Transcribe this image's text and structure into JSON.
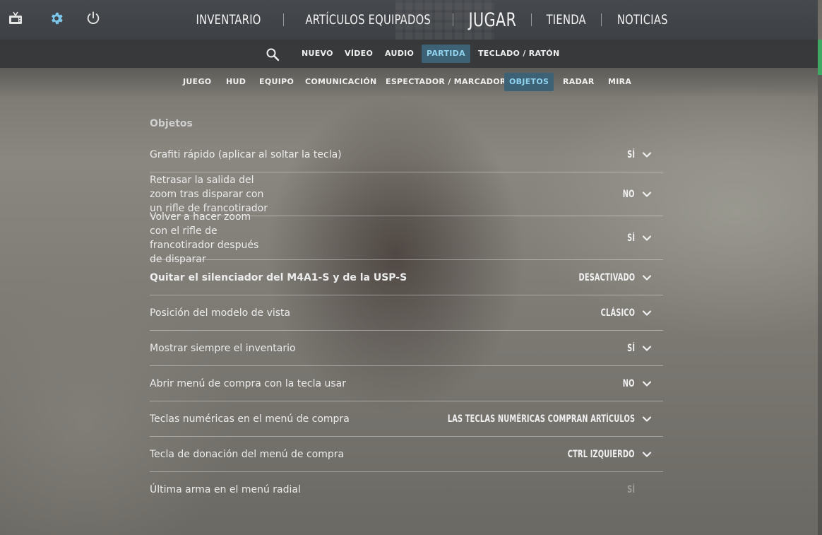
{
  "top_icons": {
    "tv": "tv-icon",
    "settings": "gear-icon",
    "power": "power-icon"
  },
  "main_nav": {
    "items": [
      "INVENTARIO",
      "ARTÍCULOS EQUIPADOS",
      "JUGAR",
      "TIENDA",
      "NOTICIAS"
    ],
    "active": "JUGAR"
  },
  "settings_tabs": {
    "items": [
      "NUEVO",
      "VÍDEO",
      "AUDIO",
      "PARTIDA",
      "TECLADO / RATÓN"
    ],
    "active": "PARTIDA"
  },
  "game_tabs": {
    "items": [
      "JUEGO",
      "HUD",
      "EQUIPO",
      "COMUNICACIÓN",
      "ESPECTADOR / MARCADOR",
      "OBJETOS",
      "RADAR",
      "MIRA"
    ],
    "active": "OBJETOS"
  },
  "colors": {
    "accent": "#8fd3ef",
    "active_tab_bg": "#3d6275",
    "scrollbar": "#3fa863"
  },
  "section": {
    "title": "Objetos",
    "rows": [
      {
        "label": "Grafiti rápido (aplicar al soltar la tecla)",
        "value": "SÍ"
      },
      {
        "label": "Retrasar la salida del zoom tras disparar con un rifle de francotirador",
        "value": "NO"
      },
      {
        "label": "Volver a hacer zoom con el rifle de francotirador después de disparar",
        "value": "SÍ"
      },
      {
        "label": "Quitar el silenciador del M4A1-S y de la USP-S",
        "value": "DESACTIVADO"
      },
      {
        "label": "Posición del modelo de vista",
        "value": "CLÁSICO"
      },
      {
        "label": "Mostrar siempre el inventario",
        "value": "SÍ"
      },
      {
        "label": "Abrir menú de compra con la tecla usar",
        "value": "NO"
      },
      {
        "label": "Teclas numéricas en el menú de compra",
        "value": "LAS TECLAS NUMÉRICAS COMPRAN ARTÍCULOS"
      },
      {
        "label": "Tecla de donación del menú de compra",
        "value": "CTRL IZQUIERDO"
      },
      {
        "label": "Última arma en el menú radial",
        "value": "SÍ"
      }
    ]
  }
}
